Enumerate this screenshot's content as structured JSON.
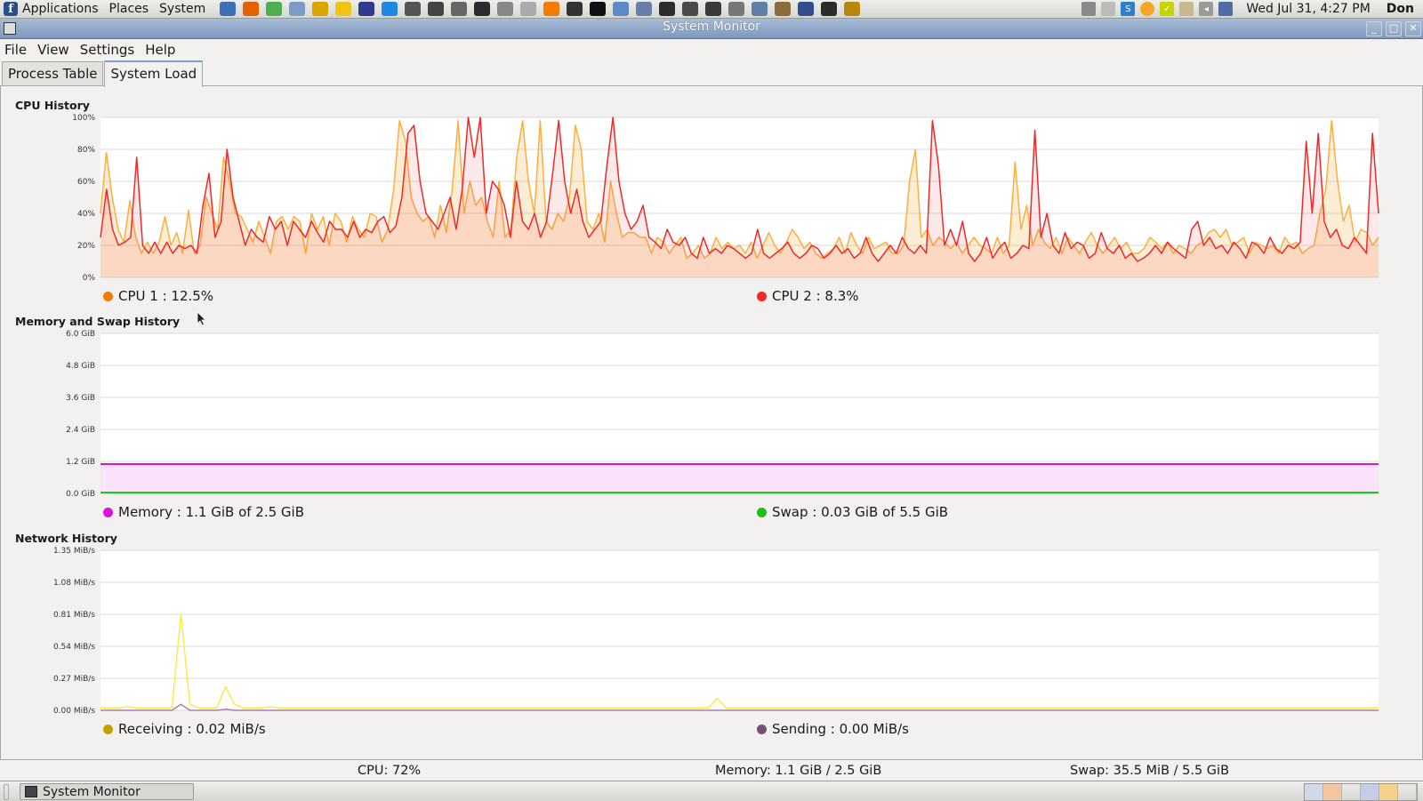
{
  "top_panel": {
    "menus": [
      "Applications",
      "Places",
      "System"
    ],
    "launcher_icons": [
      "thunderbird-icon",
      "firefox-icon",
      "chrome-icon",
      "text-icon",
      "globe-icon",
      "notes-icon",
      "cube-icon",
      "s-icon",
      "gimp-icon",
      "camera-icon",
      "screenshot-icon",
      "app-icon",
      "webcam-icon",
      "scanner-icon",
      "vlc-icon",
      "biohazard-icon",
      "a-icon",
      "dialog-icon",
      "network-icon",
      "terminal-icon",
      "media-icon",
      "monitor-icon",
      "binary-icon",
      "search-doc-icon",
      "paint-icon",
      "selector-icon",
      "system-monitor-icon",
      "magnifier-icon"
    ],
    "clock": "Wed Jul 31,  4:27 PM",
    "user": "Don"
  },
  "window": {
    "title": "System Monitor"
  },
  "menubar": {
    "items": [
      "File",
      "View",
      "Settings",
      "Help"
    ]
  },
  "tabs": [
    {
      "label": "Process Table",
      "active": false
    },
    {
      "label": "System Load",
      "active": true
    }
  ],
  "cpu": {
    "title": "CPU History",
    "y_ticks": [
      "100%",
      "80%",
      "60%",
      "40%",
      "20%",
      "0%"
    ],
    "legend": [
      {
        "label": "CPU 1 : 12.5%",
        "color": "#f57900"
      },
      {
        "label": "CPU 2 : 8.3%",
        "color": "#ef2929"
      }
    ]
  },
  "memory": {
    "title": "Memory and Swap History",
    "y_ticks": [
      "6.0 GiB",
      "4.8 GiB",
      "3.6 GiB",
      "2.4 GiB",
      "1.2 GiB",
      "0.0 GiB"
    ],
    "legend": [
      {
        "label": "Memory : 1.1 GiB of 2.5 GiB",
        "color": "#d914d9"
      },
      {
        "label": "Swap : 0.03 GiB of 5.5 GiB",
        "color": "#16c216"
      }
    ]
  },
  "network": {
    "title": "Network History",
    "y_ticks": [
      "1.35 MiB/s",
      "1.08 MiB/s",
      "0.81 MiB/s",
      "0.54 MiB/s",
      "0.27 MiB/s",
      "0.00 MiB/s"
    ],
    "legend": [
      {
        "label": "Receiving : 0.02 MiB/s",
        "color": "#c4a000"
      },
      {
        "label": "Sending : 0.00 MiB/s",
        "color": "#75507b"
      }
    ]
  },
  "status_bar": {
    "cpu": "CPU: 72%",
    "memory": "Memory: 1.1 GiB / 2.5 GiB",
    "swap": "Swap: 35.5 MiB / 5.5 GiB"
  },
  "taskbar": {
    "task": "System Monitor"
  },
  "chart_data": [
    {
      "type": "line",
      "title": "CPU History",
      "ylim": [
        0,
        100
      ],
      "series": [
        {
          "name": "CPU 1 : 12.5%",
          "values": [
            40,
            78,
            50,
            30,
            22,
            48,
            25,
            15,
            22,
            15,
            22,
            38,
            20,
            28,
            15,
            42,
            15,
            20,
            50,
            40,
            30,
            75,
            60,
            40,
            38,
            30,
            22,
            35,
            25,
            15,
            35,
            38,
            30,
            38,
            35,
            15,
            40,
            30,
            38,
            20,
            40,
            35,
            22,
            38,
            30,
            25,
            40,
            38,
            22,
            30,
            55,
            98,
            85,
            50,
            40,
            35,
            38,
            25,
            45,
            28,
            55,
            98,
            40,
            60,
            45,
            50,
            35,
            25,
            60,
            25,
            30,
            75,
            98,
            60,
            40,
            98,
            35,
            30,
            40,
            35,
            50,
            95,
            80,
            35,
            30,
            40,
            22,
            60,
            40,
            25,
            28,
            28,
            25,
            25,
            15,
            25,
            22,
            15,
            20,
            25,
            12,
            15,
            20,
            12,
            15,
            25,
            18,
            22,
            18,
            20,
            15,
            22,
            12,
            20,
            28,
            20,
            15,
            22,
            30,
            25,
            18,
            22,
            15,
            12,
            15,
            18,
            25,
            15,
            28,
            20,
            15,
            25,
            18,
            20,
            22,
            15,
            15,
            20,
            60,
            80,
            25,
            30,
            20,
            25,
            22,
            18,
            22,
            15,
            20,
            25,
            20,
            18,
            15,
            25,
            15,
            20,
            72,
            30,
            45,
            20,
            30,
            22,
            18,
            25,
            15,
            25,
            20,
            15,
            22,
            28,
            20,
            15,
            20,
            25,
            18,
            22,
            15,
            15,
            18,
            25,
            22,
            18,
            22,
            15,
            20,
            18,
            15,
            20,
            22,
            28,
            30,
            25,
            30,
            20,
            22,
            25,
            15,
            22,
            20,
            18,
            20,
            15,
            25,
            20,
            22,
            15,
            18,
            20,
            40,
            55,
            98,
            60,
            35,
            45,
            22,
            30,
            28,
            20,
            25
          ]
        },
        {
          "name": "CPU 2 : 8.3%",
          "values": [
            25,
            55,
            30,
            20,
            22,
            25,
            75,
            20,
            15,
            22,
            15,
            22,
            15,
            20,
            18,
            20,
            15,
            45,
            65,
            25,
            35,
            80,
            50,
            35,
            20,
            30,
            25,
            22,
            38,
            30,
            35,
            20,
            35,
            30,
            25,
            35,
            28,
            22,
            35,
            30,
            30,
            25,
            35,
            25,
            30,
            28,
            35,
            38,
            28,
            32,
            50,
            90,
            95,
            60,
            40,
            35,
            30,
            40,
            50,
            30,
            55,
            100,
            75,
            100,
            40,
            60,
            55,
            45,
            25,
            60,
            35,
            30,
            40,
            25,
            35,
            65,
            98,
            60,
            40,
            55,
            35,
            25,
            30,
            35,
            70,
            100,
            60,
            40,
            30,
            35,
            45,
            25,
            22,
            18,
            30,
            22,
            20,
            25,
            15,
            12,
            25,
            15,
            18,
            15,
            20,
            18,
            15,
            12,
            15,
            30,
            15,
            12,
            15,
            18,
            22,
            15,
            12,
            15,
            20,
            18,
            12,
            15,
            20,
            15,
            18,
            12,
            15,
            25,
            15,
            10,
            15,
            20,
            15,
            25,
            18,
            15,
            20,
            15,
            98,
            70,
            20,
            30,
            20,
            35,
            15,
            10,
            15,
            25,
            12,
            18,
            22,
            12,
            15,
            20,
            18,
            92,
            25,
            40,
            20,
            15,
            28,
            18,
            22,
            20,
            12,
            15,
            28,
            18,
            15,
            20,
            12,
            15,
            10,
            12,
            15,
            20,
            15,
            22,
            18,
            15,
            12,
            30,
            35,
            20,
            25,
            18,
            20,
            15,
            22,
            18,
            12,
            22,
            20,
            15,
            25,
            18,
            15,
            20,
            18,
            22,
            85,
            40,
            90,
            35,
            25,
            30,
            20,
            18,
            25,
            20,
            15,
            90,
            40
          ]
        }
      ]
    },
    {
      "type": "area",
      "title": "Memory and Swap History",
      "ylim": [
        0,
        6.0
      ],
      "series": [
        {
          "name": "Memory : 1.1 GiB of 2.5 GiB",
          "values": [
            1.1,
            1.1,
            1.1,
            1.1,
            1.1,
            1.1,
            1.1,
            1.1,
            1.1,
            1.1,
            1.1,
            1.1,
            1.1,
            1.1,
            1.1,
            1.1,
            1.1,
            1.1,
            1.1,
            1.1
          ]
        },
        {
          "name": "Swap : 0.03 GiB of 5.5 GiB",
          "values": [
            0.03,
            0.03,
            0.03,
            0.03,
            0.03,
            0.03,
            0.03,
            0.03,
            0.03,
            0.03,
            0.03,
            0.03,
            0.03,
            0.03,
            0.03,
            0.03,
            0.03,
            0.03,
            0.03,
            0.03
          ]
        }
      ]
    },
    {
      "type": "line",
      "title": "Network History",
      "ylim": [
        0,
        1.35
      ],
      "series": [
        {
          "name": "Receiving : 0.02 MiB/s",
          "values": [
            0.02,
            0.02,
            0.02,
            0.03,
            0.02,
            0.02,
            0.02,
            0.02,
            0.02,
            0.81,
            0.05,
            0.02,
            0.02,
            0.02,
            0.2,
            0.05,
            0.02,
            0.02,
            0.02,
            0.03,
            0.02,
            0.02,
            0.02,
            0.02,
            0.02,
            0.02,
            0.02,
            0.02,
            0.02,
            0.02,
            0.02,
            0.02,
            0.02,
            0.02,
            0.02,
            0.02,
            0.02,
            0.02,
            0.02,
            0.02,
            0.02,
            0.02,
            0.02,
            0.02,
            0.02,
            0.02,
            0.02,
            0.02,
            0.02,
            0.02,
            0.02,
            0.02,
            0.02,
            0.02,
            0.02,
            0.02,
            0.02,
            0.02,
            0.02,
            0.02,
            0.02,
            0.02,
            0.02,
            0.02,
            0.02,
            0.02,
            0.02,
            0.02,
            0.02,
            0.1,
            0.02,
            0.02,
            0.02,
            0.02,
            0.02,
            0.02,
            0.02,
            0.02,
            0.02,
            0.02,
            0.02,
            0.02,
            0.02,
            0.02,
            0.02,
            0.02,
            0.02,
            0.02,
            0.02,
            0.02,
            0.02,
            0.02,
            0.02,
            0.02,
            0.02,
            0.02,
            0.02,
            0.02,
            0.02,
            0.02,
            0.02,
            0.02,
            0.02,
            0.02,
            0.02,
            0.02,
            0.02,
            0.02,
            0.02,
            0.02,
            0.02,
            0.02,
            0.02,
            0.02,
            0.02,
            0.02,
            0.02,
            0.02,
            0.02,
            0.02,
            0.02,
            0.02,
            0.02,
            0.02,
            0.02,
            0.02,
            0.02,
            0.02,
            0.02,
            0.02,
            0.02,
            0.02,
            0.02,
            0.02,
            0.02,
            0.02,
            0.02,
            0.02,
            0.02,
            0.02,
            0.02,
            0.02,
            0.02,
            0.02
          ]
        },
        {
          "name": "Sending : 0.00 MiB/s",
          "values": [
            0.0,
            0.0,
            0.0,
            0.0,
            0.0,
            0.0,
            0.0,
            0.0,
            0.0,
            0.05,
            0.0,
            0.0,
            0.0,
            0.0,
            0.01,
            0.0,
            0.0,
            0.0,
            0.0,
            0.0,
            0.0,
            0.0,
            0.0,
            0.0,
            0.0,
            0.0,
            0.0,
            0.0,
            0.0,
            0.0,
            0.0,
            0.0,
            0.0,
            0.0,
            0.0,
            0.0,
            0.0,
            0.0,
            0.0,
            0.0,
            0.0,
            0.0,
            0.0,
            0.0,
            0.0,
            0.0,
            0.0,
            0.0,
            0.0,
            0.0,
            0.0,
            0.0,
            0.0,
            0.0,
            0.0,
            0.0,
            0.0,
            0.0,
            0.0,
            0.0,
            0.0,
            0.0,
            0.0,
            0.0,
            0.0,
            0.0,
            0.0,
            0.0,
            0.0,
            0.0,
            0.0,
            0.0,
            0.0,
            0.0,
            0.0,
            0.0,
            0.0,
            0.0,
            0.0,
            0.0,
            0.0,
            0.0,
            0.0,
            0.0,
            0.0,
            0.0,
            0.0,
            0.0,
            0.0,
            0.0,
            0.0,
            0.0,
            0.0,
            0.0,
            0.0,
            0.0,
            0.0,
            0.0,
            0.0,
            0.0,
            0.0,
            0.0,
            0.0,
            0.0,
            0.0,
            0.0,
            0.0,
            0.0,
            0.0,
            0.0,
            0.0,
            0.0,
            0.0,
            0.0,
            0.0,
            0.0,
            0.0,
            0.0,
            0.0,
            0.0,
            0.0,
            0.0,
            0.0,
            0.0,
            0.0,
            0.0,
            0.0,
            0.0,
            0.0,
            0.0,
            0.0,
            0.0,
            0.0,
            0.0,
            0.0,
            0.0,
            0.0,
            0.0,
            0.0,
            0.0,
            0.0,
            0.0,
            0.0,
            0.0
          ]
        }
      ]
    }
  ]
}
